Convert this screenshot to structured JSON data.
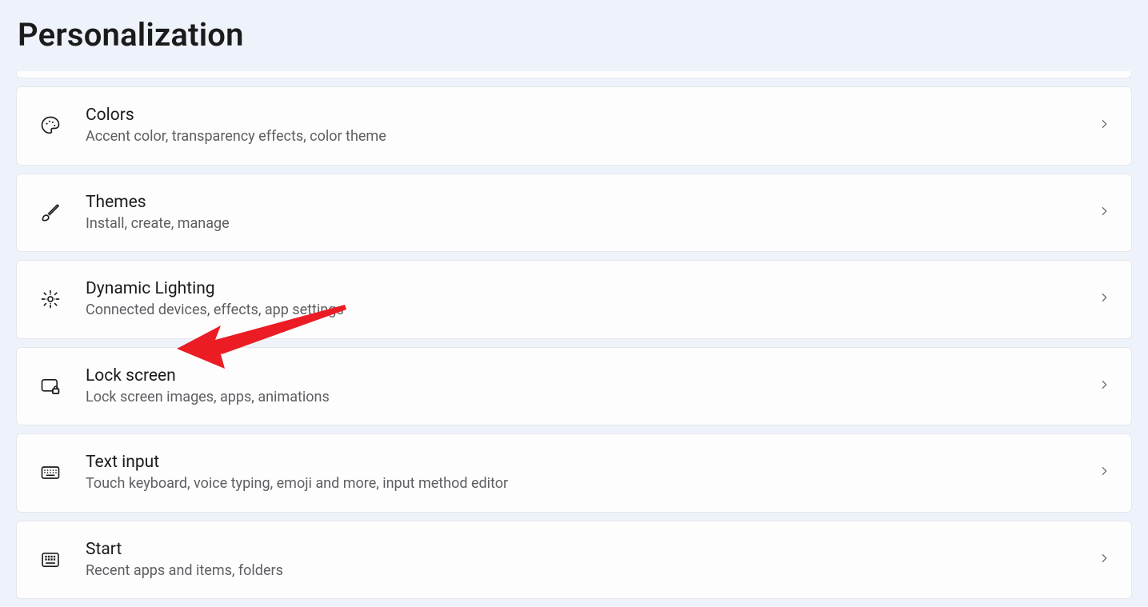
{
  "page": {
    "title": "Personalization"
  },
  "items": [
    {
      "id": "colors",
      "icon": "palette",
      "title": "Colors",
      "subtitle": "Accent color, transparency effects, color theme"
    },
    {
      "id": "themes",
      "icon": "brush",
      "title": "Themes",
      "subtitle": "Install, create, manage"
    },
    {
      "id": "dynamic-lighting",
      "icon": "sparkle",
      "title": "Dynamic Lighting",
      "subtitle": "Connected devices, effects, app settings"
    },
    {
      "id": "lock-screen",
      "icon": "lock-screen",
      "title": "Lock screen",
      "subtitle": "Lock screen images, apps, animations"
    },
    {
      "id": "text-input",
      "icon": "keyboard",
      "title": "Text input",
      "subtitle": "Touch keyboard, voice typing, emoji and more, input method editor"
    },
    {
      "id": "start",
      "icon": "start-grid",
      "title": "Start",
      "subtitle": "Recent apps and items, folders"
    }
  ],
  "annotation": {
    "target_item_id": "lock-screen",
    "kind": "red-arrow"
  }
}
